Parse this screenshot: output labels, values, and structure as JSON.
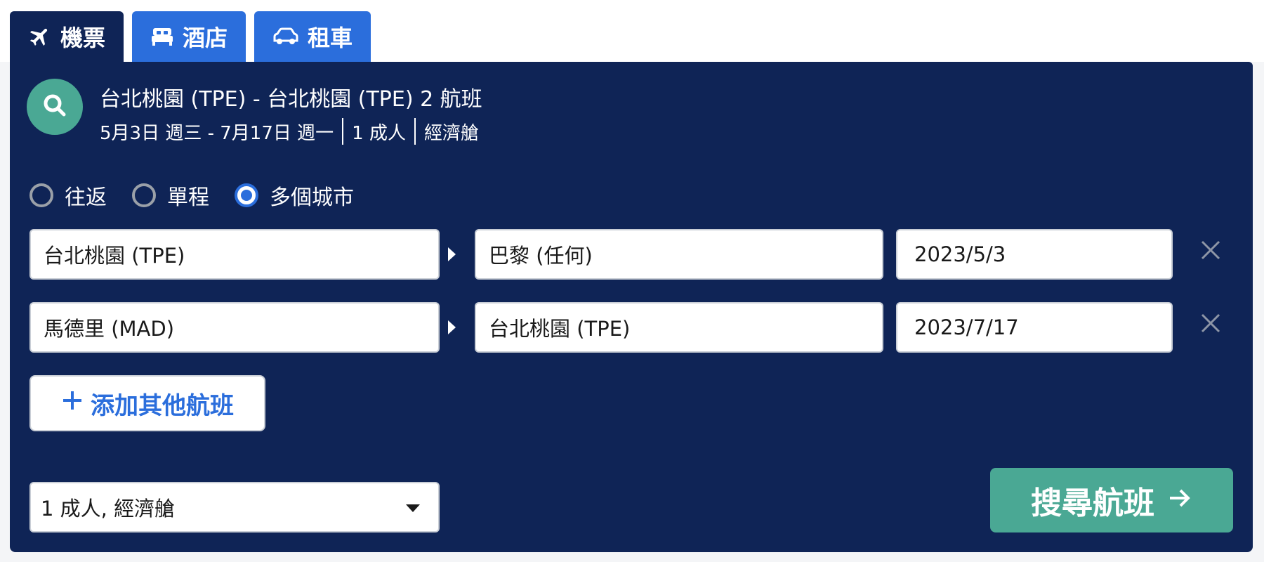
{
  "tabs": [
    {
      "label": "機票",
      "icon": "airplane-icon",
      "active": true
    },
    {
      "label": "酒店",
      "icon": "bed-icon",
      "active": false
    },
    {
      "label": "租車",
      "icon": "car-icon",
      "active": false
    }
  ],
  "summary": {
    "icon": "search-icon",
    "title": "台北桃園 (TPE) - 台北桃園 (TPE) 2 航班",
    "dates": "5月3日 週三 - 7月17日 週一",
    "travelers": "1 成人",
    "cabin": "經濟艙"
  },
  "trip_types": [
    {
      "label": "往返",
      "checked": false
    },
    {
      "label": "單程",
      "checked": false
    },
    {
      "label": "多個城市",
      "checked": true
    }
  ],
  "flights": [
    {
      "from": "台北桃園 (TPE)",
      "to": "巴黎 (任何)",
      "date": "2023/5/3"
    },
    {
      "from": "馬德里 (MAD)",
      "to": "台北桃園 (TPE)",
      "date": "2023/7/17"
    }
  ],
  "add_flight_label": "添加其他航班",
  "passengers_select": "1 成人, 經濟艙",
  "search_button": "搜尋航班",
  "colors": {
    "panel": "#0f2456",
    "tab": "#2b6edc",
    "accent_green": "#4aa894",
    "radio_checked": "#2b6edc"
  }
}
